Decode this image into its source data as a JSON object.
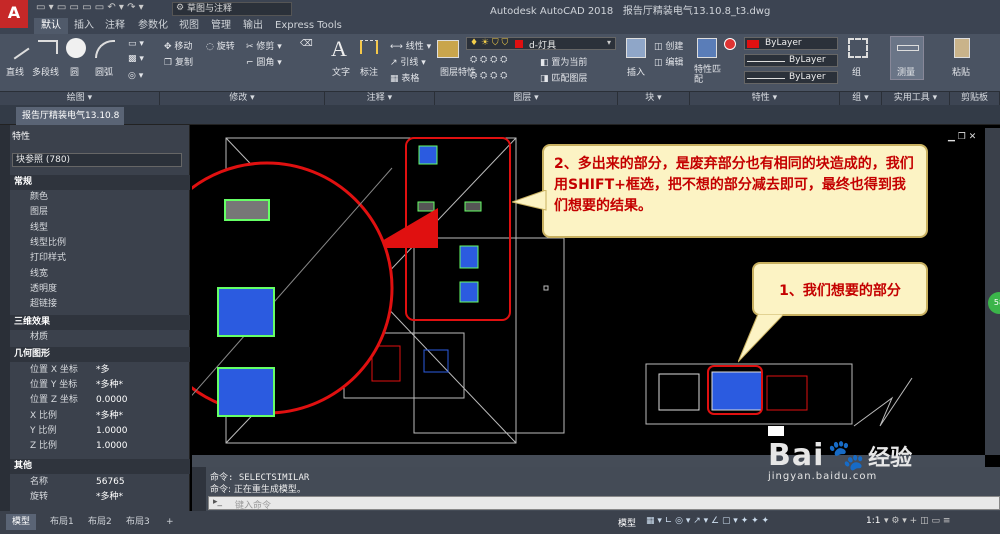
{
  "app": {
    "title_left": "Autodesk AutoCAD 2018",
    "title_right": "报告厅精装电气13.10.8_t3.dwg",
    "workspace": "草图与注释"
  },
  "ribbon_tabs": [
    "默认",
    "插入",
    "注释",
    "参数化",
    "视图",
    "管理",
    "输出",
    "Express Tools"
  ],
  "ribbon": {
    "draw_tools": [
      "直线",
      "多段线",
      "圆",
      "圆弧"
    ],
    "modify_tools": [
      "移动",
      "旋转",
      "修剪",
      "复制",
      "圆角"
    ],
    "annot_tools": [
      "文字",
      "标注"
    ],
    "annot_small": [
      "线性",
      "引线",
      "表格"
    ],
    "layer_name": "d-灯具",
    "layer_tools": [
      "图层特性",
      "置为当前",
      "匹配图层"
    ],
    "block_tools": [
      "插入",
      "创建",
      "编辑"
    ],
    "prop_tools": [
      "特性匹配"
    ],
    "bylayer": [
      "ByLayer",
      "ByLayer",
      "ByLayer"
    ],
    "group": "组",
    "measure": "测量",
    "paste": "粘贴"
  },
  "panels": [
    "绘图 ▾",
    "修改 ▾",
    "注释 ▾",
    "图层 ▾",
    "块 ▾",
    "特性 ▾",
    "组 ▾",
    "实用工具 ▾",
    "剪贴板"
  ],
  "doc_tab": "报告厅精装电气13.10.8",
  "properties": {
    "title": "特性",
    "selection": "块参照 (780)",
    "sections": {
      "general": "常规",
      "threed": "三维效果",
      "geometry": "几何图形",
      "misc": "其他"
    },
    "general_rows": [
      "颜色",
      "图层",
      "线型",
      "线型比例",
      "打印样式",
      "线宽",
      "透明度",
      "超链接"
    ],
    "threed_rows": [
      "材质"
    ],
    "geometry_rows": [
      {
        "k": "位置 X 坐标",
        "v": "*多"
      },
      {
        "k": "位置 Y 坐标",
        "v": "*多种*"
      },
      {
        "k": "位置 Z 坐标",
        "v": "0.0000"
      },
      {
        "k": "X 比例",
        "v": "*多种*"
      },
      {
        "k": "Y 比例",
        "v": "1.0000"
      },
      {
        "k": "Z 比例",
        "v": "1.0000"
      }
    ],
    "misc_rows": [
      {
        "k": "名称",
        "v": "56765"
      },
      {
        "k": "旋转",
        "v": "*多种*"
      }
    ]
  },
  "command": {
    "line1": "命令: SELECTSIMILAR",
    "line2": "命令: 正在重生成模型。",
    "placeholder": "键入命令"
  },
  "layout_tabs": [
    "模型",
    "布局1",
    "布局2",
    "布局3"
  ],
  "status": {
    "model": "模型",
    "scale": "1:1"
  },
  "callouts": {
    "c1": "1、我们想要的部分",
    "c2": "2、多出来的部分，是废弃部分也有相同的块造成的，我们用SHIFT+框选，把不想的部分减去即可，最终也得到我们想要的结果。"
  },
  "watermark": {
    "brand": "Bai",
    "brand2": "经验",
    "url": "jingyan.baidu.com"
  },
  "colors": {
    "callout_text": "#c40000",
    "callout_bg": "#fcf3c4",
    "highlight": "#e01010",
    "block_fill": "#2b5be0"
  }
}
